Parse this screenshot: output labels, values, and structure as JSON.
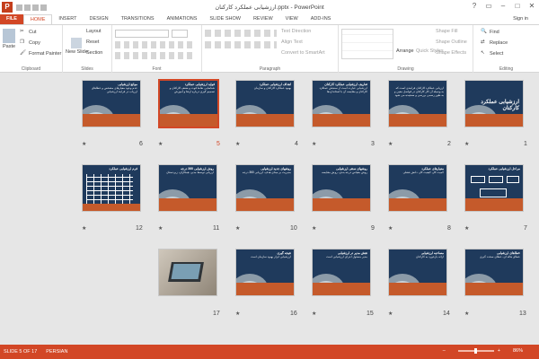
{
  "window": {
    "title": "ارزشیابی عملکرد کارکنان.pptx - PowerPoint",
    "logo": "P"
  },
  "tabs": [
    "FILE",
    "HOME",
    "INSERT",
    "DESIGN",
    "TRANSITIONS",
    "ANIMATIONS",
    "SLIDE SHOW",
    "REVIEW",
    "VIEW",
    "ADD-INS"
  ],
  "signin": "Sign in",
  "ribbon": {
    "clipboard": {
      "label": "Clipboard",
      "paste": "Paste",
      "cut": "Cut",
      "copy": "Copy",
      "painter": "Format Painter"
    },
    "slides": {
      "label": "Slides",
      "new_slide": "New Slide",
      "layout": "Layout",
      "reset": "Reset",
      "section": "Section"
    },
    "font": {
      "label": "Font"
    },
    "paragraph": {
      "label": "Paragraph",
      "text_direction": "Text Direction",
      "align_text": "Align Text",
      "smartart": "Convert to SmartArt"
    },
    "drawing": {
      "label": "Drawing",
      "arrange": "Arrange",
      "quick_styles": "Quick Styles",
      "fill": "Shape Fill",
      "outline": "Shape Outline",
      "effects": "Shape Effects"
    },
    "editing": {
      "label": "Editing",
      "find": "Find",
      "replace": "Replace",
      "select": "Select"
    }
  },
  "slides": [
    {
      "num": "1",
      "heading": "",
      "big": "ارزشیابی عملکرد کارکنان",
      "text": ""
    },
    {
      "num": "2",
      "heading": "",
      "big": "",
      "text": "ارزیابی عملکرد کارکنان فرایندی است که به وسیله آن کار کارکنان در فواصل معین و به طور رسمی بررسی و سنجیده می شود"
    },
    {
      "num": "3",
      "heading": "تعاریف ارزشیابی عملکرد کارکنان",
      "big": "",
      "text": "ارزشیابی عبارت است از سنجش عملکرد کارکنان و مقایسه آن با استانداردها"
    },
    {
      "num": "4",
      "heading": "اهداف ارزشیابی عملکرد",
      "big": "",
      "text": "بهبود عملکرد کارکنان و سازمان"
    },
    {
      "num": "5",
      "heading": "فواید ارزشیابی عملکرد",
      "big": "",
      "text": "شناسایی نقاط قوت و ضعف کارکنان و تصمیم گیری درباره ارتقا و آموزش"
    },
    {
      "num": "6",
      "heading": "موانع ارزشیابی",
      "big": "",
      "text": "عدم وجود معیارهای مشخص و خطاهای ارزیاب در فرایند ارزشیابی"
    },
    {
      "num": "7",
      "heading": "",
      "big": "",
      "text": "مراحل ارزشیابی عملکرد"
    },
    {
      "num": "8",
      "heading": "معیارهای عملکرد",
      "big": "",
      "text": "کمیت کار، کیفیت کار، دانش شغلی"
    },
    {
      "num": "9",
      "heading": "روشهای سنتی ارزشیابی",
      "big": "",
      "text": "روش مقیاس درجه بندی، روش مقایسه"
    },
    {
      "num": "10",
      "heading": "روشهای جدید ارزشیابی",
      "big": "",
      "text": "مدیریت بر مبنای هدف، ارزیابی 360 درجه"
    },
    {
      "num": "11",
      "heading": "روش ارزشیابی 360 درجه",
      "big": "",
      "text": "ارزیابی توسط مدیر، همکاران، زیردستان"
    },
    {
      "num": "12",
      "heading": "فرم ارزشیابی عملکرد",
      "big": "",
      "text": ""
    },
    {
      "num": "13",
      "heading": "خطاهای ارزشیابی",
      "big": "",
      "text": "خطای هاله ای، خطای سخت گیری"
    },
    {
      "num": "14",
      "heading": "مصاحبه ارزشیابی",
      "big": "",
      "text": "ارائه بازخورد به کارکنان"
    },
    {
      "num": "15",
      "heading": "نقش مدیر در ارزشیابی",
      "big": "",
      "text": "مدیر مسئول اجرای ارزشیابی است"
    },
    {
      "num": "16",
      "heading": "نتیجه گیری",
      "big": "",
      "text": "ارزشیابی ابزار بهبود سازمان است"
    },
    {
      "num": "17",
      "heading": "",
      "big": "",
      "text": ""
    }
  ],
  "status": {
    "slide": "SLIDE 5 OF 17",
    "language": "PERSIAN",
    "zoom": "86%"
  }
}
